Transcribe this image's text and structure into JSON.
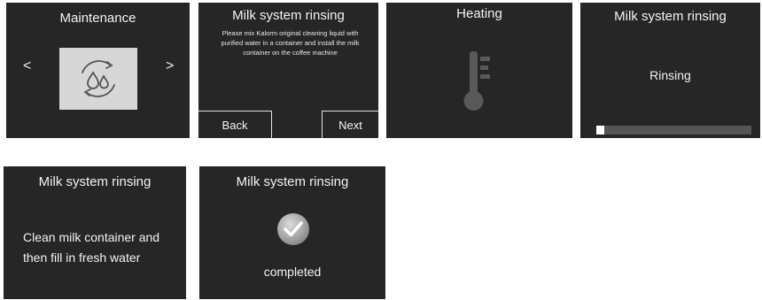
{
  "maintenance": {
    "title": "Maintenance",
    "prev_arrow": "<",
    "next_arrow": ">",
    "icon": "milk-rinse-icon"
  },
  "rinse_instruction": {
    "title": "Milk system rinsing",
    "message": "Please mix Kalorm original cleaning liquid with purified water in a container and install the milk container on the coffee machine",
    "back_label": "Back",
    "next_label": "Next"
  },
  "heating": {
    "title": "Heating",
    "icon": "thermometer-icon"
  },
  "rinsing": {
    "title": "Milk system rinsing",
    "status": "Rinsing",
    "progress_percent": 5
  },
  "clean_container": {
    "title": "Milk system rinsing",
    "message_line1": "Clean milk container and",
    "message_line2": "then fill in fresh water"
  },
  "completed": {
    "title": "Milk system rinsing",
    "status": "completed",
    "icon": "checkmark-icon"
  }
}
